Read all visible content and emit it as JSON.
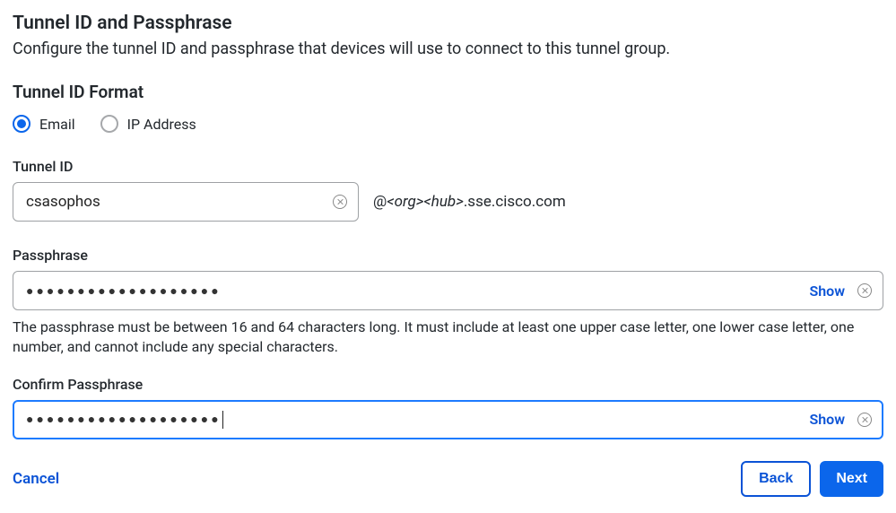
{
  "header": {
    "title": "Tunnel ID and Passphrase",
    "description": "Configure the tunnel ID and passphrase that devices will use to connect to this tunnel group."
  },
  "format": {
    "label": "Tunnel ID Format",
    "options": {
      "email": "Email",
      "ip": "IP Address"
    },
    "selected": "email"
  },
  "tunnelId": {
    "label": "Tunnel ID",
    "value": "csasophos",
    "suffixPrefix": "@",
    "suffixOrg": "<org>",
    "suffixHub": "<hub>",
    "suffixDomain": ".sse.cisco.com"
  },
  "passphrase": {
    "label": "Passphrase",
    "masked": "●●●●●●●●●●●●●●●●●●●",
    "show": "Show",
    "help": "The passphrase must be between 16 and 64 characters long. It must include at least one upper case letter, one lower case letter, one number, and cannot include any special characters."
  },
  "confirm": {
    "label": "Confirm Passphrase",
    "masked": "●●●●●●●●●●●●●●●●●●●",
    "show": "Show"
  },
  "footer": {
    "cancel": "Cancel",
    "back": "Back",
    "next": "Next"
  }
}
